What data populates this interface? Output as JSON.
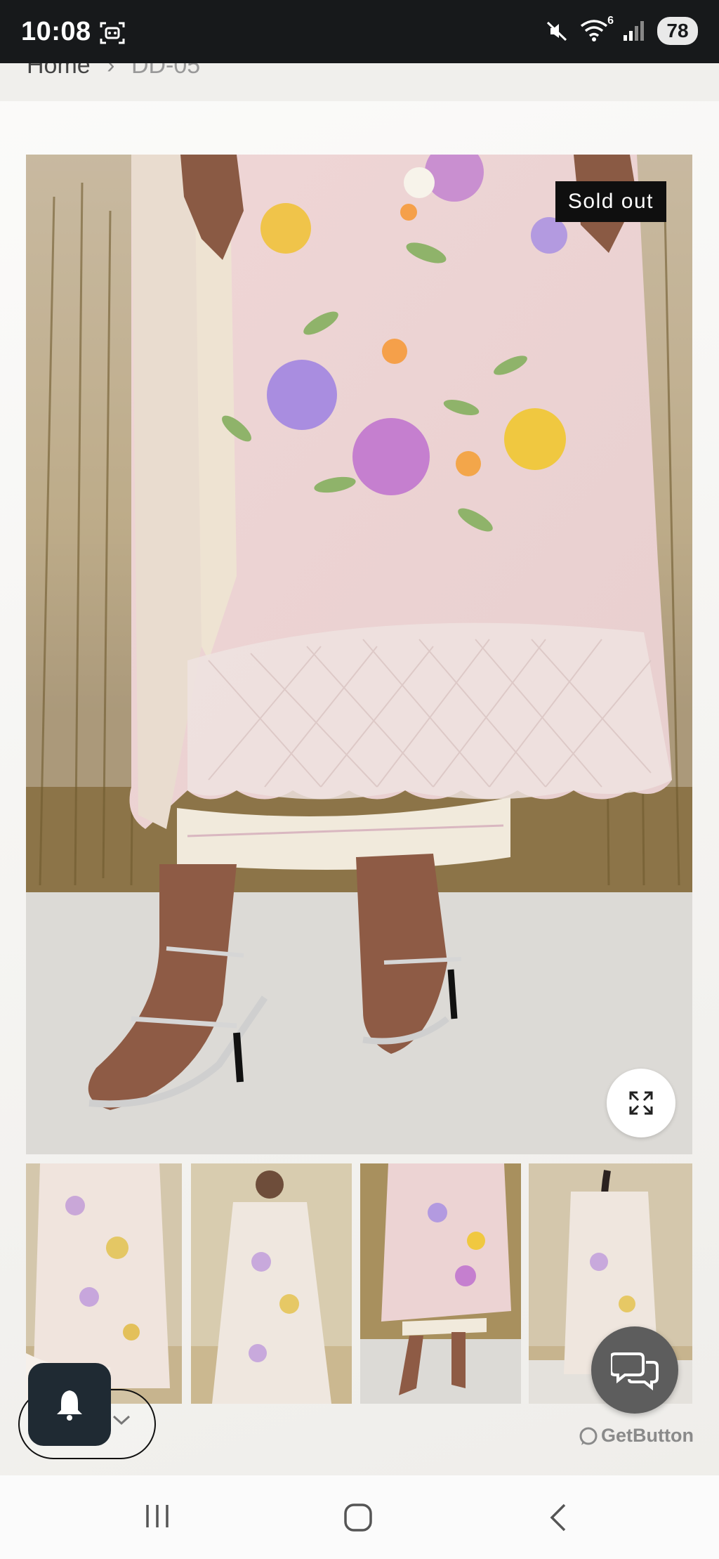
{
  "status_bar": {
    "time": "10:08",
    "icons": [
      "screenshot-icon",
      "mute-icon",
      "wifi-icon",
      "signal-icon"
    ],
    "wifi_badge": "6",
    "battery": "78"
  },
  "breadcrumb": {
    "home": "Home",
    "separator": "›",
    "current": "DD-05"
  },
  "product": {
    "sold_out_label": "Sold out",
    "zoom_icon": "expand-icon"
  },
  "thumbnails": [
    {
      "name": "front-view"
    },
    {
      "name": "full-look"
    },
    {
      "name": "detail-view"
    },
    {
      "name": "back-view"
    }
  ],
  "floating": {
    "bell_icon": "bell-icon",
    "chat_icon": "chat-icon",
    "powered_by": "GetButton"
  },
  "nav_bar": {
    "icons": [
      "recent-apps-icon",
      "home-icon",
      "back-icon"
    ]
  },
  "colors": {
    "status_bar": "#17191b",
    "badge_bg": "#0f0f0f",
    "bell_button": "#1f2a33",
    "chat_button": "#5d5d5d"
  }
}
